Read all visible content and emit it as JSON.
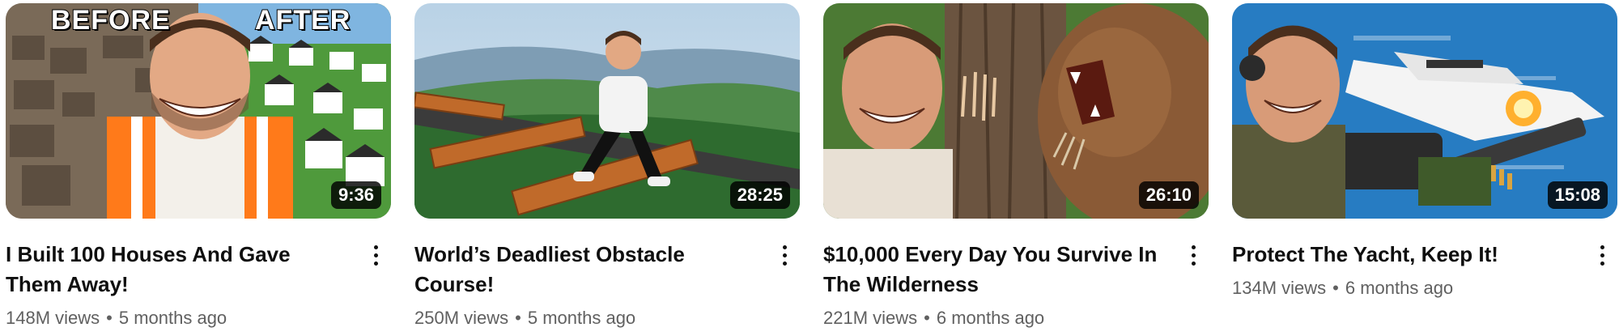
{
  "videos": [
    {
      "title": "I Built 100 Houses And Gave Them Away!",
      "duration": "9:36",
      "views": "148M views",
      "age": "5 months ago",
      "thumbnail_text": {
        "left": "BEFORE",
        "right": "AFTER"
      }
    },
    {
      "title": "World’s Deadliest Obstacle Course!",
      "duration": "28:25",
      "views": "250M views",
      "age": "5 months ago"
    },
    {
      "title": "$10,000 Every Day You Survive In The Wilderness",
      "duration": "26:10",
      "views": "221M views",
      "age": "6 months ago"
    },
    {
      "title": "Protect The Yacht, Keep It!",
      "duration": "15:08",
      "views": "134M views",
      "age": "6 months ago"
    }
  ],
  "separator": "•",
  "icons": {
    "more": "more-vert-icon"
  }
}
